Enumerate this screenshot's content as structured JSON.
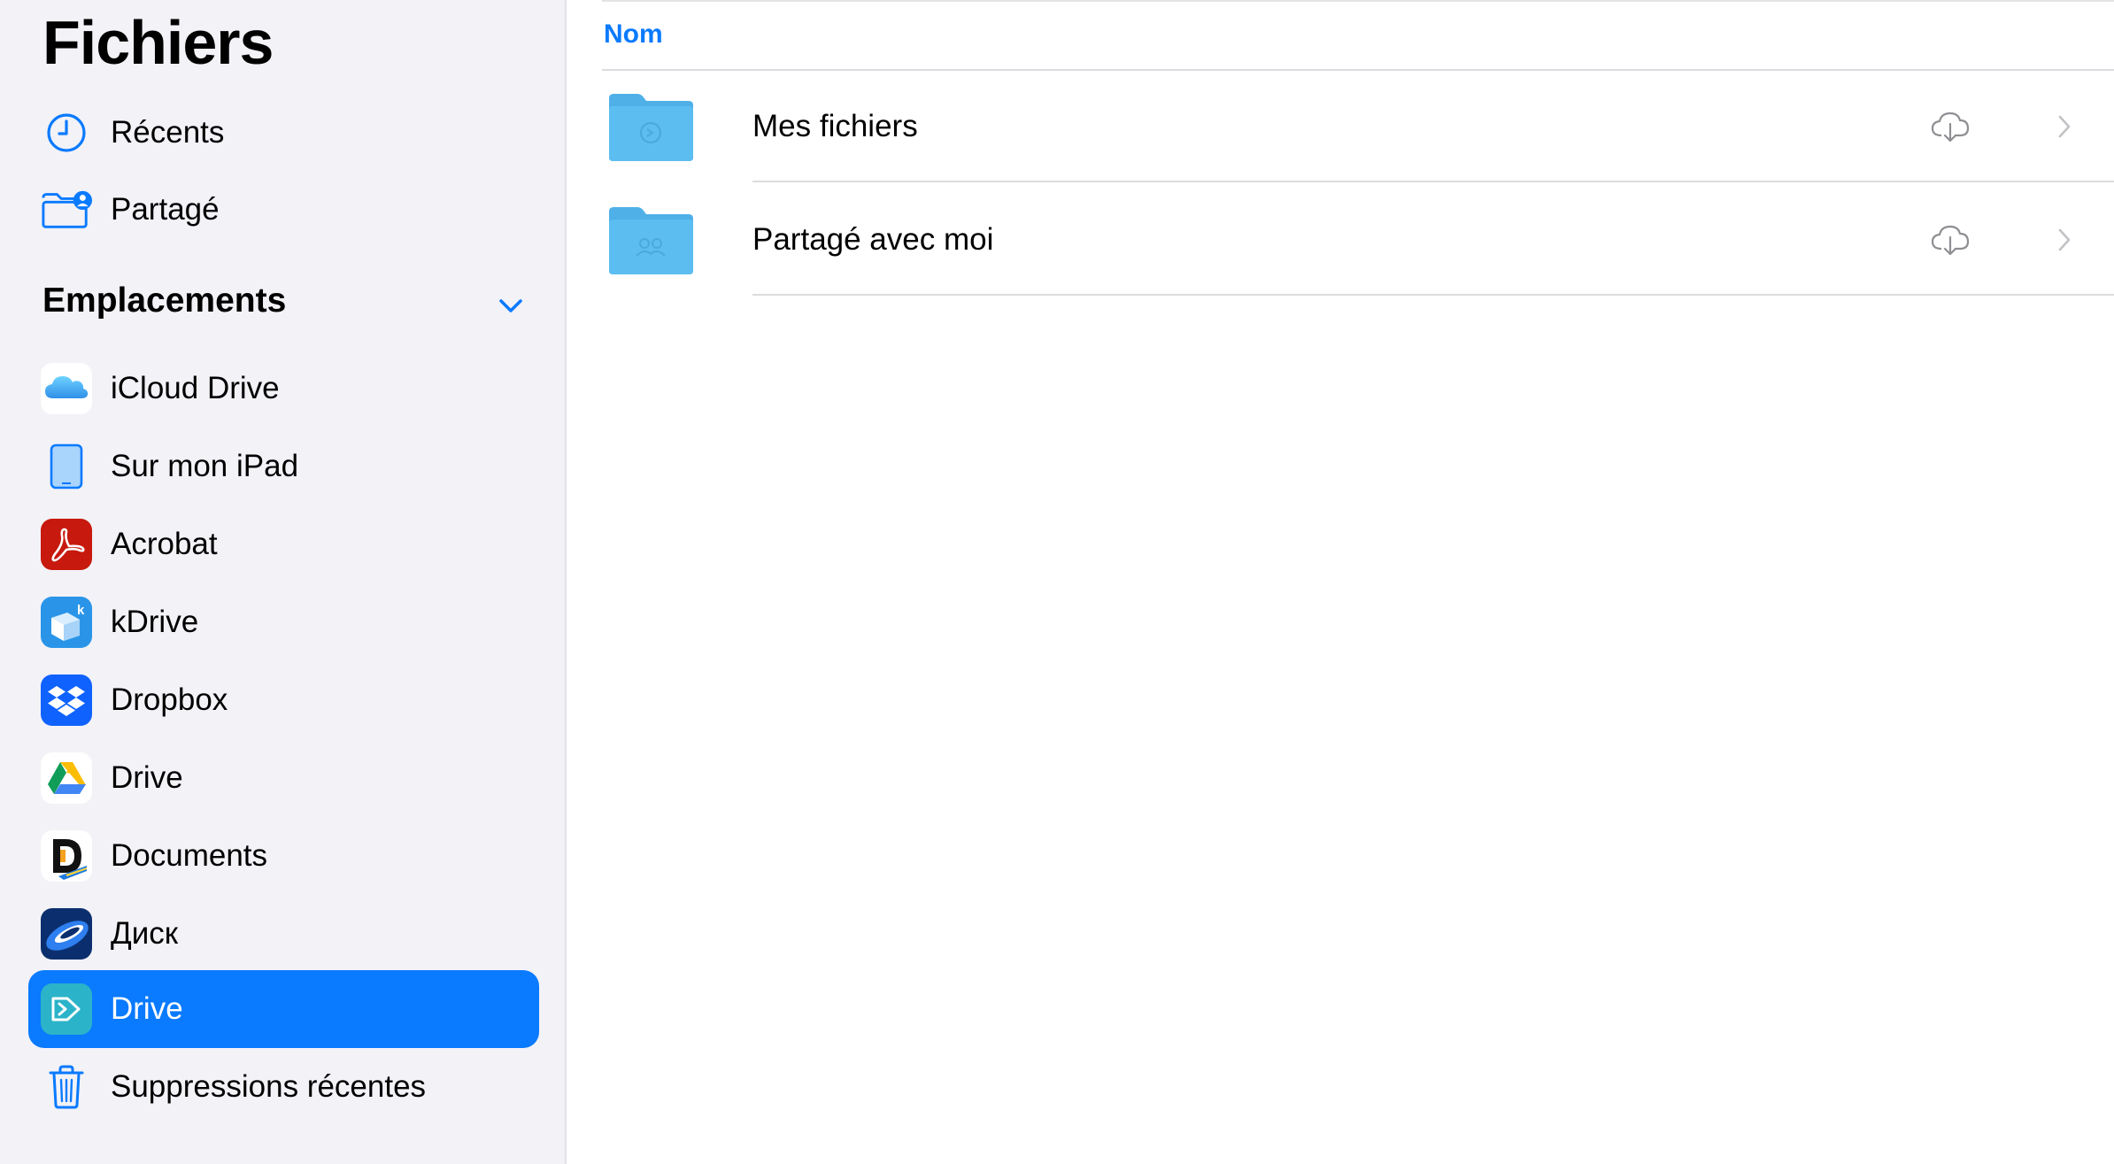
{
  "sidebar": {
    "title": "Fichiers",
    "favorites": [
      {
        "label": "Récents",
        "icon": "clock-icon"
      },
      {
        "label": "Partagé",
        "icon": "shared-folder-icon"
      }
    ],
    "locations_title": "Emplacements",
    "locations": [
      {
        "label": "iCloud Drive",
        "icon": "icloud-drive-icon"
      },
      {
        "label": "Sur mon iPad",
        "icon": "ipad-icon"
      },
      {
        "label": "Acrobat",
        "icon": "acrobat-icon"
      },
      {
        "label": "kDrive",
        "icon": "kdrive-icon"
      },
      {
        "label": "Dropbox",
        "icon": "dropbox-icon"
      },
      {
        "label": "Drive",
        "icon": "google-drive-icon"
      },
      {
        "label": "Documents",
        "icon": "documents-icon"
      },
      {
        "label": "Диск",
        "icon": "yandex-disk-icon"
      },
      {
        "label": "Drive",
        "icon": "synology-drive-icon",
        "selected": true
      },
      {
        "label": "Suppressions récentes",
        "icon": "trash-icon"
      }
    ]
  },
  "main": {
    "column_header": "Nom",
    "rows": [
      {
        "name": "Mes fichiers",
        "icon": "folder-icon",
        "status_icon": "cloud-download-icon"
      },
      {
        "name": "Partagé avec moi",
        "icon": "shared-folder-icon",
        "status_icon": "cloud-download-icon"
      }
    ]
  },
  "colors": {
    "accent": "#0a7aff",
    "sidebar_bg": "#f2f2f7",
    "folder": "#5ab9ee",
    "selected_bg": "#0a7aff"
  }
}
